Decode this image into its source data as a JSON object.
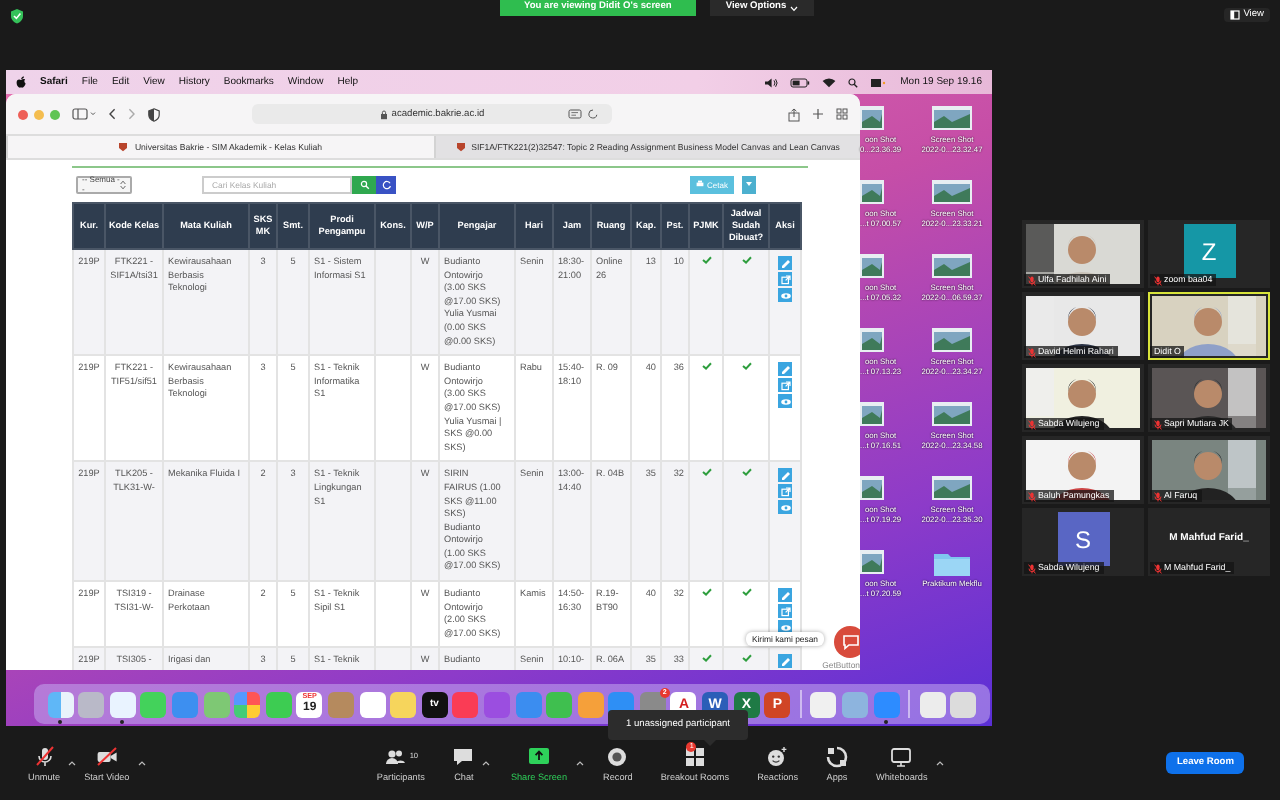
{
  "zoom_bar": {
    "banner": "You are viewing Didit O's screen",
    "view_options": "View Options",
    "view": "View"
  },
  "mac_menu": {
    "app": "Safari",
    "items": [
      "File",
      "Edit",
      "View",
      "History",
      "Bookmarks",
      "Window",
      "Help"
    ],
    "clock": "Mon 19 Sep 19.16"
  },
  "safari": {
    "url": "academic.bakrie.ac.id",
    "tabs": [
      {
        "label": "Universitas Bakrie - SIM Akademik - Kelas Kuliah",
        "selected": true
      },
      {
        "label": "SIF1A/FTK221(2)32547: Topic 2 Reading Assignment Business Model Canvas and Lean Canvas",
        "selected": false
      }
    ]
  },
  "filters": {
    "select": "-- Semua --",
    "search_placeholder": "Cari Kelas Kuliah",
    "print": "Cetak"
  },
  "table": {
    "columns": [
      "Kur.",
      "Kode Kelas",
      "Mata Kuliah",
      "SKS MK",
      "Smt.",
      "Prodi Pengampu",
      "Kons.",
      "W/P",
      "Pengajar",
      "Hari",
      "Jam",
      "Ruang",
      "Kap.",
      "Pst.",
      "PJMK",
      "Jadwal Sudah Dibuat?",
      "Aksi"
    ],
    "rows": [
      {
        "cells": [
          "219P",
          "FTK221 - SIF1A/tsi31",
          "Kewirausahaan Berbasis Teknologi",
          "3",
          "5",
          "S1 - Sistem Informasi S1",
          "",
          "W",
          "Budianto Ontowirjo (3.00 SKS @17.00 SKS) Yulia Yusmai (0.00 SKS @0.00 SKS)",
          "Senin",
          "18:30-21:00",
          "Online 26",
          "13",
          "10"
        ],
        "pjmk": true,
        "scheduled": true
      },
      {
        "cells": [
          "219P",
          "FTK221 - TIF51/sif51",
          "Kewirausahaan Berbasis Teknologi",
          "3",
          "5",
          "S1 - Teknik Informatika S1",
          "",
          "W",
          "Budianto Ontowirjo (3.00 SKS @17.00 SKS) Yulia Yusmai | SKS @0.00 SKS)",
          "Rabu",
          "15:40-18:10",
          "R. 09",
          "40",
          "36"
        ],
        "pjmk": true,
        "scheduled": true
      },
      {
        "cells": [
          "219P",
          "TLK205 - TLK31-W-",
          "Mekanika Fluida I",
          "2",
          "3",
          "S1 - Teknik Lingkungan S1",
          "",
          "W",
          "SIRIN FAIRUS (1.00 SKS @11.00 SKS) Budianto Ontowirjo (1.00 SKS @17.00 SKS)",
          "Senin",
          "13:00-14:40",
          "R. 04B",
          "35",
          "32"
        ],
        "pjmk": true,
        "scheduled": true
      },
      {
        "cells": [
          "219P",
          "TSI319 - TSI31-W-",
          "Drainase Perkotaan",
          "2",
          "5",
          "S1 - Teknik Sipil S1",
          "",
          "W",
          "Budianto Ontowirjo (2.00 SKS @17.00 SKS)",
          "Kamis",
          "14:50-16:30",
          "R.19-BT90",
          "40",
          "32"
        ],
        "pjmk": true,
        "scheduled": true
      },
      {
        "cells": [
          "219P",
          "TSI305 -",
          "Irigasi dan",
          "3",
          "5",
          "S1 - Teknik",
          "",
          "W",
          "Budianto",
          "Senin",
          "10:10-",
          "R. 06A",
          "35",
          "33"
        ],
        "pjmk": true,
        "scheduled": true
      }
    ]
  },
  "chat_widget": {
    "bubble": "Kirimi kami pesan",
    "credit": "GetButton"
  },
  "desktop": [
    {
      "kind": "screenshot",
      "lines": [
        "oon Shot",
        "0...23.36.39"
      ]
    },
    {
      "kind": "screenshot",
      "lines": [
        "Screen Shot",
        "2022-0...23.32.47"
      ]
    },
    {
      "kind": "screenshot",
      "lines": [
        "oon Shot",
        "...t 07.00.57"
      ]
    },
    {
      "kind": "screenshot",
      "lines": [
        "Screen Shot",
        "2022-0...23.33.21"
      ]
    },
    {
      "kind": "screenshot",
      "lines": [
        "oon Shot",
        "...t 07.05.32"
      ]
    },
    {
      "kind": "screenshot",
      "lines": [
        "Screen Shot",
        "2022-0...06.59.37"
      ]
    },
    {
      "kind": "screenshot",
      "lines": [
        "oon Shot",
        "...t 07.13.23"
      ]
    },
    {
      "kind": "screenshot",
      "lines": [
        "Screen Shot",
        "2022-0...23.34.27"
      ]
    },
    {
      "kind": "screenshot",
      "lines": [
        "oon Shot",
        "...t 07.16.51"
      ]
    },
    {
      "kind": "screenshot",
      "lines": [
        "Screen Shot",
        "2022-0...23.34.58"
      ]
    },
    {
      "kind": "screenshot",
      "lines": [
        "oon Shot",
        "...t 07.19.29"
      ]
    },
    {
      "kind": "screenshot",
      "lines": [
        "Screen Shot",
        "2022-0...23.35.30"
      ]
    },
    {
      "kind": "screenshot",
      "lines": [
        "oon Shot",
        "...t 07.20.59"
      ]
    },
    {
      "kind": "folder",
      "lines": [
        "Praktikum Mekflu"
      ]
    }
  ],
  "dock": [
    {
      "kind": "finder",
      "running": true
    },
    {
      "kind": "launchpad",
      "running": false
    },
    {
      "kind": "safari",
      "running": true
    },
    {
      "kind": "messages",
      "running": false
    },
    {
      "kind": "mail",
      "running": false
    },
    {
      "kind": "maps",
      "running": false
    },
    {
      "kind": "photos",
      "running": false
    },
    {
      "kind": "facetime",
      "running": false
    },
    {
      "kind": "calendar",
      "month": "SEP",
      "day": "19",
      "running": false
    },
    {
      "kind": "contacts",
      "running": false
    },
    {
      "kind": "reminders",
      "running": false
    },
    {
      "kind": "notes",
      "running": false
    },
    {
      "kind": "tv",
      "label": "tv",
      "running": false
    },
    {
      "kind": "music",
      "running": false
    },
    {
      "kind": "podcasts",
      "running": false
    },
    {
      "kind": "keynote",
      "running": false
    },
    {
      "kind": "numbers",
      "running": false
    },
    {
      "kind": "pages",
      "running": false
    },
    {
      "kind": "appstore",
      "running": false
    },
    {
      "kind": "settings",
      "badge": "2",
      "running": false
    },
    {
      "kind": "acrobat",
      "label": "A",
      "running": false
    },
    {
      "kind": "word",
      "label": "W",
      "running": false
    },
    {
      "kind": "excel",
      "label": "X",
      "running": false
    },
    {
      "kind": "powerpoint",
      "label": "P",
      "running": false
    },
    {
      "kind": "divider"
    },
    {
      "kind": "textedit",
      "running": false
    },
    {
      "kind": "preview",
      "running": false
    },
    {
      "kind": "zoom",
      "running": true
    },
    {
      "kind": "divider"
    },
    {
      "kind": "docs",
      "running": false
    },
    {
      "kind": "trash",
      "running": false
    }
  ],
  "gallery": [
    {
      "kind": "video",
      "name": "Ulfa Fadhilah Aini",
      "muted": true,
      "active_speaker": false
    },
    {
      "kind": "avatar",
      "letter": "Z",
      "color": "#1597a6",
      "name": "zoom baa04",
      "muted": true,
      "active_speaker": false
    },
    {
      "kind": "video",
      "name": "David Helmi Rahari",
      "muted": true,
      "active_speaker": false
    },
    {
      "kind": "video",
      "name": "Didit O",
      "muted": false,
      "active_speaker": true
    },
    {
      "kind": "video",
      "name": "Sabda Wilujeng",
      "muted": true,
      "active_speaker": false
    },
    {
      "kind": "video",
      "name": "Sapri Mutiara JK",
      "muted": true,
      "active_speaker": false
    },
    {
      "kind": "video",
      "name": "Baluh Pamungkas",
      "muted": true,
      "active_speaker": false
    },
    {
      "kind": "video",
      "name": "Al Faruq",
      "muted": true,
      "active_speaker": false
    },
    {
      "kind": "avatar",
      "letter": "S",
      "color": "#5966c4",
      "name": "Sabda Wilujeng",
      "muted": true,
      "active_speaker": false
    },
    {
      "kind": "name",
      "title": "M Mahfud Farid_",
      "name": "M Mahfud Farid_",
      "muted": true,
      "active_speaker": false
    }
  ],
  "toolbar": {
    "items": [
      {
        "kind": "mic",
        "label": "Unmute",
        "off": true,
        "menu": true
      },
      {
        "kind": "camera",
        "label": "Start Video",
        "off": true,
        "menu": true
      },
      {
        "kind": "participants",
        "label": "Participants",
        "count": "10",
        "menu": false
      },
      {
        "kind": "chat",
        "label": "Chat",
        "menu": true
      },
      {
        "kind": "share",
        "label": "Share Screen",
        "menu": true
      },
      {
        "kind": "record",
        "label": "Record",
        "menu": false
      },
      {
        "kind": "breakout",
        "label": "Breakout Rooms",
        "badge": "1",
        "menu": false
      },
      {
        "kind": "reactions",
        "label": "Reactions",
        "menu": false
      },
      {
        "kind": "apps",
        "label": "Apps",
        "menu": false
      },
      {
        "kind": "whiteboard",
        "label": "Whiteboards",
        "menu": true
      }
    ],
    "leave": "Leave Room",
    "tooltip": "1 unassigned participant"
  }
}
